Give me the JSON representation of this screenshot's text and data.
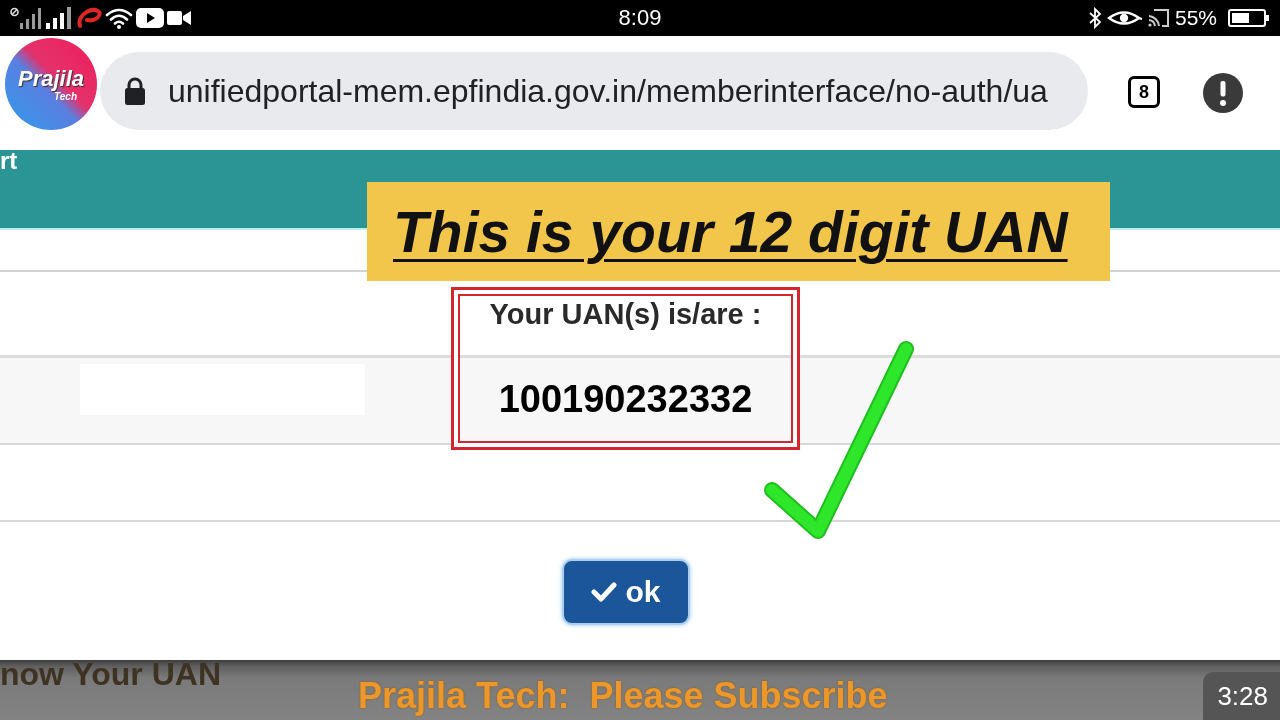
{
  "status_bar": {
    "time": "8:09",
    "battery": "55%"
  },
  "browser": {
    "url": "unifiedportal-mem.epfindia.gov.in/memberinterface/no-auth/ua",
    "tab_count": "8"
  },
  "channel_logo": {
    "title": "Prajila",
    "subtitle": "Tech"
  },
  "page": {
    "header_text": "rt"
  },
  "annotation": {
    "text": "This is your 12 digit UAN"
  },
  "uan_dialog": {
    "label": "Your UAN(s) is/are :",
    "uan": "100190232332",
    "button": "ok"
  },
  "video_overlay": {
    "caption": "now Your UAN",
    "banner": "Prajila Tech:  Please Subscribe",
    "timestamp": "3:28"
  }
}
